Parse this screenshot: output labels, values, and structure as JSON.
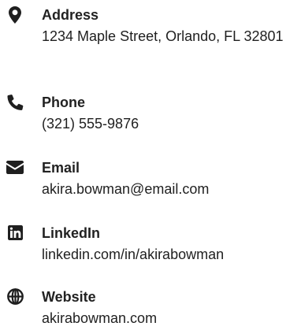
{
  "contacts": [
    {
      "label": "Address",
      "value": "1234 Maple Street, Orlando, FL 32801",
      "icon": "map-marker-icon"
    },
    {
      "label": "Phone",
      "value": "(321) 555-9876",
      "icon": "phone-icon"
    },
    {
      "label": "Email",
      "value": "akira.bowman@email.com",
      "icon": "envelope-icon"
    },
    {
      "label": "LinkedIn",
      "value": "linkedin.com/in/akirabowman",
      "icon": "linkedin-icon"
    },
    {
      "label": "Website",
      "value": "akirabowman.com",
      "icon": "globe-icon"
    }
  ],
  "colors": {
    "text": "#222222",
    "icon": "#1f1f1f",
    "background": "#ffffff"
  }
}
